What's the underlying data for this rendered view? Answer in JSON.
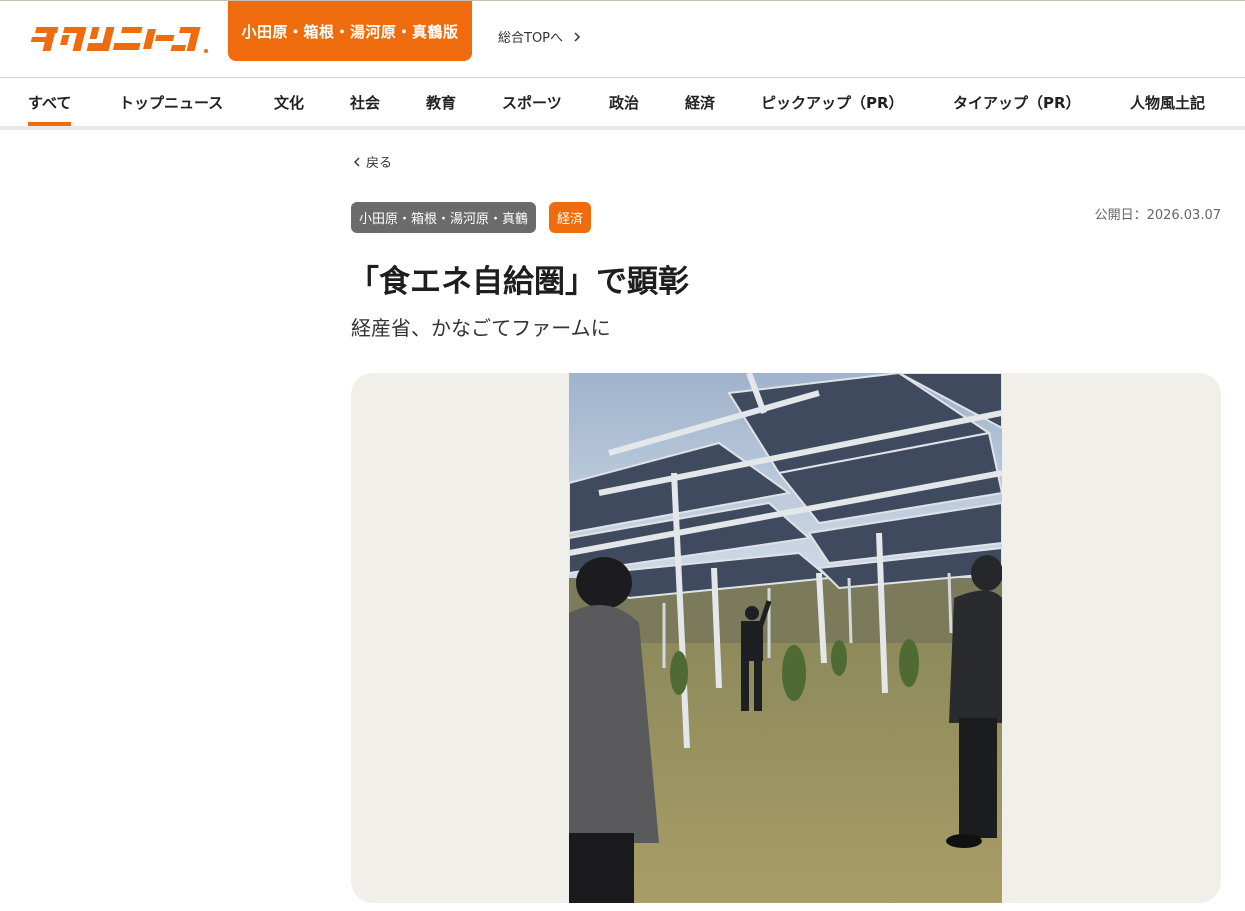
{
  "header": {
    "logo_text": "タウンニュース",
    "edition_label": "小田原・箱根・湯河原・真鶴版",
    "top_link_label": "総合TOPへ",
    "brand_color": "#ef6c0e"
  },
  "nav": {
    "items": [
      {
        "label": "すべて",
        "active": true
      },
      {
        "label": "トップニュース"
      },
      {
        "label": "文化"
      },
      {
        "label": "社会"
      },
      {
        "label": "教育"
      },
      {
        "label": "スポーツ"
      },
      {
        "label": "政治"
      },
      {
        "label": "経済"
      },
      {
        "label": "ピックアップ（PR）"
      },
      {
        "label": "タイアップ（PR）"
      },
      {
        "label": "人物風土記"
      }
    ]
  },
  "article": {
    "back_label": "戻る",
    "tags": [
      "小田原・箱根・湯河原・真鶴",
      "経済"
    ],
    "published": "公開日：2026.03.07",
    "title": "「食エネ自給圏」で顕彰",
    "subtitle": "経産省、かなごてファームに"
  }
}
